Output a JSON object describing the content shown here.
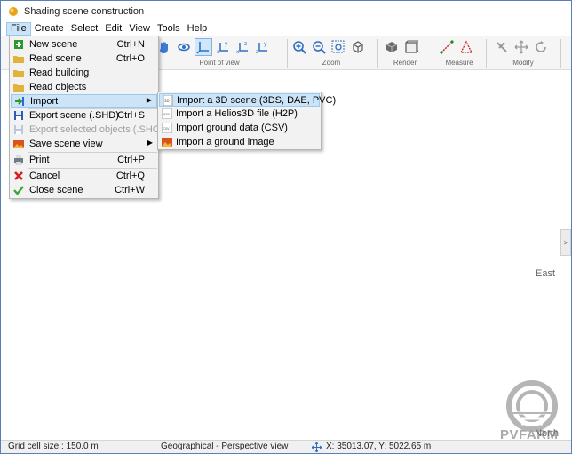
{
  "window": {
    "title": "Shading scene construction"
  },
  "menubar": {
    "items": [
      {
        "label": "File",
        "active": true
      },
      {
        "label": "Create"
      },
      {
        "label": "Select"
      },
      {
        "label": "Edit"
      },
      {
        "label": "View"
      },
      {
        "label": "Tools"
      },
      {
        "label": "Help"
      }
    ]
  },
  "toolbar": {
    "groups": [
      {
        "label": "Point of view",
        "icons": [
          "orbit-icon",
          "axes-perspective-icon",
          "view-xy-icon",
          "view-xz-icon",
          "view-zy-icon"
        ]
      },
      {
        "label": "Zoom",
        "icons": [
          "zoom-in-icon",
          "zoom-out-icon",
          "zoom-window-icon",
          "zoom-extent-icon"
        ]
      },
      {
        "label": "Render",
        "icons": [
          "shaded-cube-icon",
          "wireframe-cube-icon"
        ]
      },
      {
        "label": "Measure",
        "icons": [
          "measure-distance-icon",
          "measure-angle-icon"
        ]
      },
      {
        "label": "Modify",
        "icons": [
          "move-tool-icon",
          "pan-arrows-icon",
          "rotate-icon"
        ]
      }
    ]
  },
  "file_menu": {
    "items": [
      {
        "label": "New scene",
        "shortcut": "Ctrl+N",
        "icon": "new-scene-icon"
      },
      {
        "label": "Read scene",
        "shortcut": "Ctrl+O",
        "icon": "folder-icon"
      },
      {
        "label": "Read building",
        "shortcut": "",
        "icon": "folder-icon"
      },
      {
        "label": "Read objects",
        "shortcut": "",
        "icon": "folder-icon"
      },
      {
        "label": "Import",
        "shortcut": "",
        "icon": "import-icon",
        "submenu": true
      },
      {
        "label": "Export scene (.SHD)",
        "shortcut": "Ctrl+S",
        "icon": "save-icon"
      },
      {
        "label": "Export selected objects (.SHO)",
        "shortcut": "",
        "icon": "save-icon",
        "disabled": true
      },
      {
        "label": "Save scene view",
        "shortcut": "",
        "icon": "image-icon",
        "submenu": true
      },
      {
        "label": "Print",
        "shortcut": "Ctrl+P",
        "icon": "printer-icon"
      },
      {
        "label": "Cancel",
        "shortcut": "Ctrl+Q",
        "icon": "cancel-icon"
      },
      {
        "label": "Close scene",
        "shortcut": "Ctrl+W",
        "icon": "check-icon"
      }
    ]
  },
  "import_submenu": {
    "items": [
      {
        "label": "Import a 3D scene (3DS, DAE, PVC)",
        "icon": "3d-file-icon"
      },
      {
        "label": "Import a Helios3D file (H2P)",
        "icon": "h2p-file-icon"
      },
      {
        "label": "Import ground data (CSV)",
        "icon": "csv-file-icon"
      },
      {
        "label": "Import a ground image",
        "icon": "image-icon"
      }
    ]
  },
  "canvas": {
    "east_label": "East",
    "north_label": "North",
    "side_handle": ">"
  },
  "logo": {
    "text": "PVFARM"
  },
  "statusbar": {
    "grid_cell": "Grid cell size : 150.0 m",
    "view_mode": "Geographical - Perspective view",
    "coordinates": "X: 35013.07, Y: 5022.65 m"
  },
  "colors": {
    "accent_highlight": "#cce4f7",
    "highlight_border": "#99c9ef",
    "window_border": "#5a7fb8",
    "logo_gray": "#a9a9a9"
  }
}
